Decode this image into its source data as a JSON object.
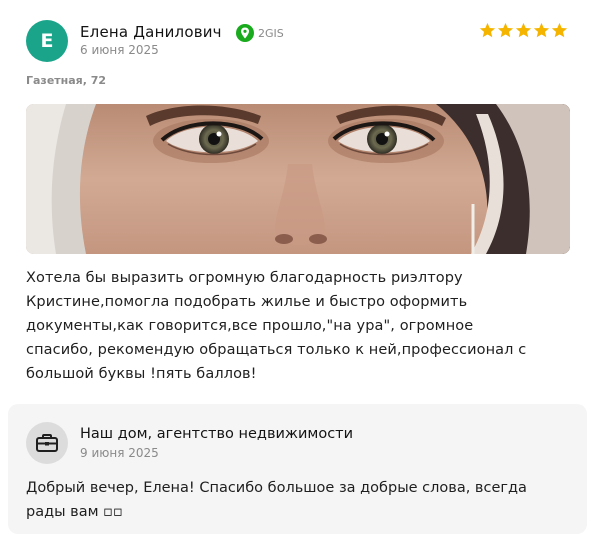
{
  "review": {
    "avatar_letter": "Е",
    "author": "Елена Данилович",
    "source": "2GIS",
    "date": "6 июня 2025",
    "rating": 5,
    "address": "Газетная, 72",
    "text": "Хотела бы выразить огромную благодарность риэлтору\nКристине,помогла подобрать жилье и быстро оформить\nдокументы,как говорится,все прошло,\"на ура\", огромное\nспасибо, рекомендую обращаться только к ней,профессионал с\nбольшой буквы !пять баллов!"
  },
  "reply": {
    "author": "Наш дом, агентство недвижимости",
    "date": "9 июня 2025",
    "text": "Добрый вечер, Елена! Спасибо большое за добрые слова, всегда\nрады вам ▫▫"
  },
  "colors": {
    "avatar_bg": "#1aa58a",
    "star": "#f5b400",
    "source_green": "#19aa1e",
    "reply_bg": "#f5f5f5"
  },
  "icons": {
    "source": "2gis-pin-icon",
    "reply_avatar": "briefcase-icon",
    "rating": "star-icon"
  }
}
